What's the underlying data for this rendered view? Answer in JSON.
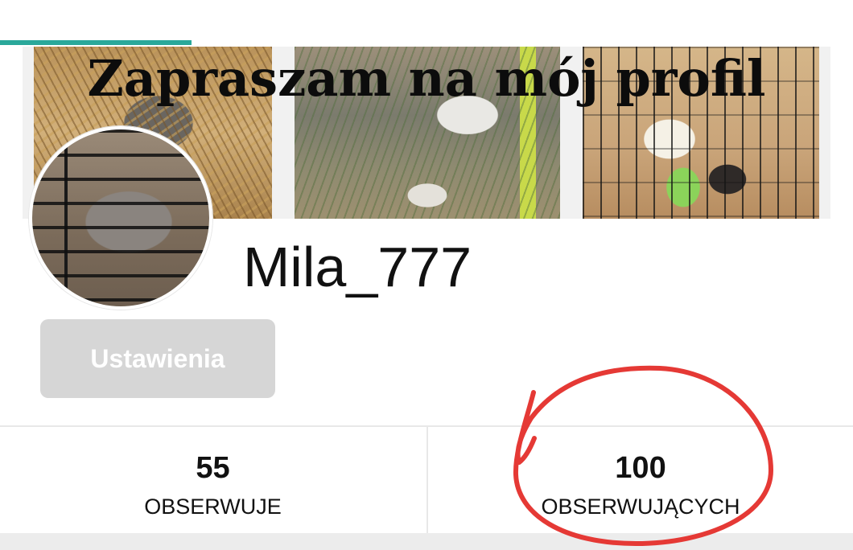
{
  "banner": {
    "text": "Zapraszam na mój profil"
  },
  "profile": {
    "username": "Mila_777"
  },
  "buttons": {
    "settings_label": "Ustawienia"
  },
  "stats": [
    {
      "value": "55",
      "label": "OBSERWUJE"
    },
    {
      "value": "100",
      "label": "OBSERWUJĄCYCH"
    }
  ],
  "colors": {
    "tab_indicator": "#2aa89a",
    "settings_button_bg": "#d6d6d6",
    "annotation": "#e53935"
  },
  "annotation": {
    "type": "hand-drawn-circle",
    "target": "followers-stat"
  }
}
